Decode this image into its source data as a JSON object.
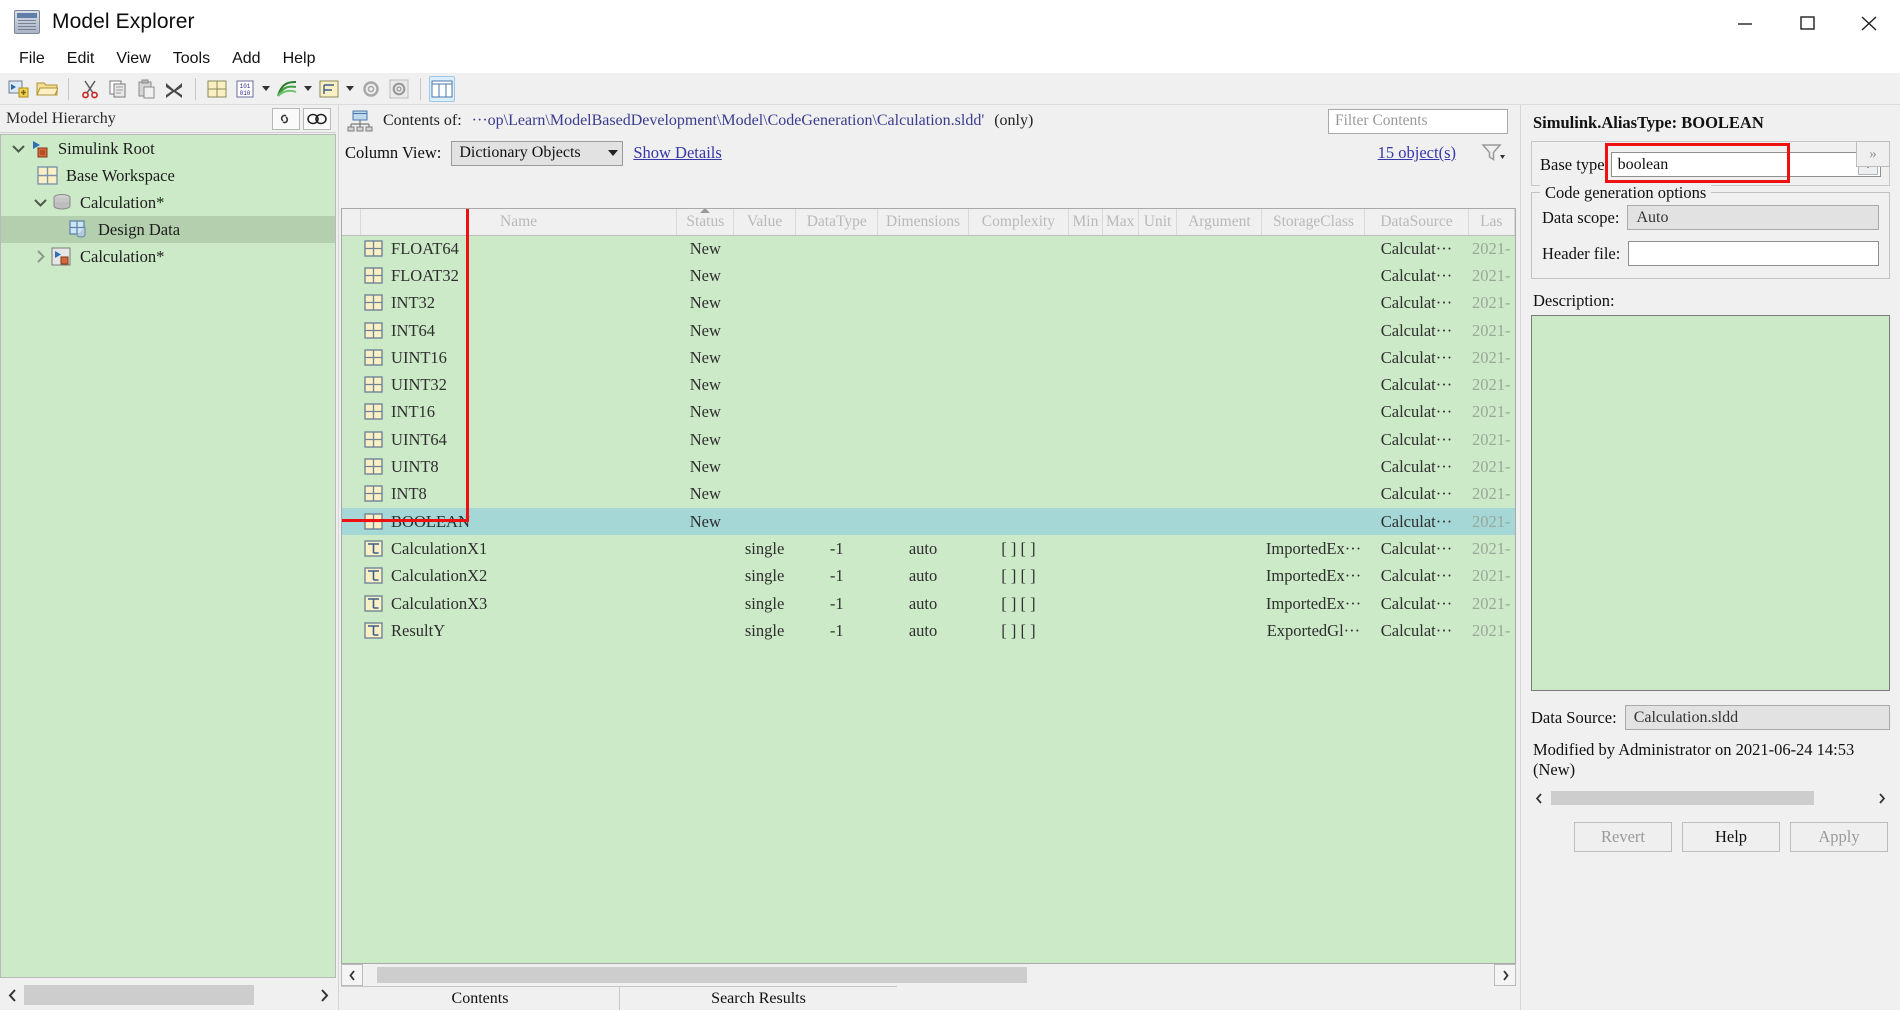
{
  "window": {
    "title": "Model Explorer",
    "app_icon": "grid-window-icon",
    "minimize": "minimize-icon",
    "maximize": "maximize-icon",
    "close": "close-icon"
  },
  "menubar": {
    "items": [
      "File",
      "Edit",
      "View",
      "Tools",
      "Add",
      "Help"
    ]
  },
  "toolbar": {
    "items": [
      "new-model-icon",
      "open-folder-icon",
      "cut-icon",
      "copy-icon",
      "paste-icon",
      "delete-x-icon",
      "base-workspace-icon",
      "code-bits-icon",
      "signal-icon",
      "hierarchy-icon",
      "config-gear-icon",
      "gear-icon",
      "columns-view-icon"
    ]
  },
  "left_panel": {
    "header": "Model Hierarchy",
    "header_buttons": [
      "link-icon",
      "mask-icon"
    ],
    "tree": [
      {
        "label": "Simulink Root",
        "icon": "simulink-root-icon",
        "twisty": "expanded",
        "indent": 0,
        "selected": false
      },
      {
        "label": "Base Workspace",
        "icon": "workspace-grid-icon",
        "twisty": "none",
        "indent": 1,
        "selected": false
      },
      {
        "label": "Calculation*",
        "icon": "dictionary-icon",
        "twisty": "expanded",
        "indent": 1,
        "selected": false
      },
      {
        "label": "Design Data",
        "icon": "design-data-icon",
        "twisty": "none",
        "indent": 2,
        "selected": true
      },
      {
        "label": "Calculation*",
        "icon": "model-icon",
        "twisty": "collapsed",
        "indent": 1,
        "selected": false
      }
    ]
  },
  "center_panel": {
    "contents_label": "Contents of:",
    "contents_path": "···op\\Learn\\ModelBasedDevelopment\\Model\\CodeGeneration\\Calculation.sldd'",
    "contents_only": "(only)",
    "filter_placeholder": "Filter Contents",
    "column_view_label": "Column View:",
    "column_view_value": "Dictionary Objects",
    "show_details": "Show Details",
    "object_count": "15 object(s)",
    "filter_icon": "funnel-icon",
    "columns": [
      "",
      "Name",
      "Status",
      "Value",
      "DataType",
      "Dimensions",
      "Complexity",
      "Min",
      "Max",
      "Unit",
      "Argument",
      "StorageClass",
      "DataSource",
      "Las"
    ],
    "sorted_column": "Status",
    "rows": [
      {
        "icon": "alias-type-icon",
        "name": "FLOAT64",
        "status": "New",
        "value": "",
        "datatype": "",
        "dimensions": "",
        "complexity": "",
        "min": "",
        "max": "",
        "unit": "",
        "argument": "",
        "storageclass": "",
        "datasource": "Calculat···",
        "last": "2021-",
        "selected": false
      },
      {
        "icon": "alias-type-icon",
        "name": "FLOAT32",
        "status": "New",
        "value": "",
        "datatype": "",
        "dimensions": "",
        "complexity": "",
        "min": "",
        "max": "",
        "unit": "",
        "argument": "",
        "storageclass": "",
        "datasource": "Calculat···",
        "last": "2021-",
        "selected": false
      },
      {
        "icon": "alias-type-icon",
        "name": "INT32",
        "status": "New",
        "value": "",
        "datatype": "",
        "dimensions": "",
        "complexity": "",
        "min": "",
        "max": "",
        "unit": "",
        "argument": "",
        "storageclass": "",
        "datasource": "Calculat···",
        "last": "2021-",
        "selected": false
      },
      {
        "icon": "alias-type-icon",
        "name": "INT64",
        "status": "New",
        "value": "",
        "datatype": "",
        "dimensions": "",
        "complexity": "",
        "min": "",
        "max": "",
        "unit": "",
        "argument": "",
        "storageclass": "",
        "datasource": "Calculat···",
        "last": "2021-",
        "selected": false
      },
      {
        "icon": "alias-type-icon",
        "name": "UINT16",
        "status": "New",
        "value": "",
        "datatype": "",
        "dimensions": "",
        "complexity": "",
        "min": "",
        "max": "",
        "unit": "",
        "argument": "",
        "storageclass": "",
        "datasource": "Calculat···",
        "last": "2021-",
        "selected": false
      },
      {
        "icon": "alias-type-icon",
        "name": "UINT32",
        "status": "New",
        "value": "",
        "datatype": "",
        "dimensions": "",
        "complexity": "",
        "min": "",
        "max": "",
        "unit": "",
        "argument": "",
        "storageclass": "",
        "datasource": "Calculat···",
        "last": "2021-",
        "selected": false
      },
      {
        "icon": "alias-type-icon",
        "name": "INT16",
        "status": "New",
        "value": "",
        "datatype": "",
        "dimensions": "",
        "complexity": "",
        "min": "",
        "max": "",
        "unit": "",
        "argument": "",
        "storageclass": "",
        "datasource": "Calculat···",
        "last": "2021-",
        "selected": false
      },
      {
        "icon": "alias-type-icon",
        "name": "UINT64",
        "status": "New",
        "value": "",
        "datatype": "",
        "dimensions": "",
        "complexity": "",
        "min": "",
        "max": "",
        "unit": "",
        "argument": "",
        "storageclass": "",
        "datasource": "Calculat···",
        "last": "2021-",
        "selected": false
      },
      {
        "icon": "alias-type-icon",
        "name": "UINT8",
        "status": "New",
        "value": "",
        "datatype": "",
        "dimensions": "",
        "complexity": "",
        "min": "",
        "max": "",
        "unit": "",
        "argument": "",
        "storageclass": "",
        "datasource": "Calculat···",
        "last": "2021-",
        "selected": false
      },
      {
        "icon": "alias-type-icon",
        "name": "INT8",
        "status": "New",
        "value": "",
        "datatype": "",
        "dimensions": "",
        "complexity": "",
        "min": "",
        "max": "",
        "unit": "",
        "argument": "",
        "storageclass": "",
        "datasource": "Calculat···",
        "last": "2021-",
        "selected": false
      },
      {
        "icon": "alias-type-icon",
        "name": "BOOLEAN",
        "status": "New",
        "value": "",
        "datatype": "",
        "dimensions": "",
        "complexity": "",
        "min": "",
        "max": "",
        "unit": "",
        "argument": "",
        "storageclass": "",
        "datasource": "Calculat···",
        "last": "2021-",
        "selected": true
      },
      {
        "icon": "parameter-icon",
        "name": "CalculationX1",
        "status": "",
        "value": "single",
        "datatype": "-1",
        "dimensions": "auto",
        "complexity": "[ ] [ ]",
        "min": "",
        "max": "",
        "unit": "",
        "argument": "",
        "storageclass": "ImportedEx···",
        "datasource": "Calculat···",
        "last": "2021-",
        "selected": false
      },
      {
        "icon": "parameter-icon",
        "name": "CalculationX2",
        "status": "",
        "value": "single",
        "datatype": "-1",
        "dimensions": "auto",
        "complexity": "[ ] [ ]",
        "min": "",
        "max": "",
        "unit": "",
        "argument": "",
        "storageclass": "ImportedEx···",
        "datasource": "Calculat···",
        "last": "2021-",
        "selected": false
      },
      {
        "icon": "parameter-icon",
        "name": "CalculationX3",
        "status": "",
        "value": "single",
        "datatype": "-1",
        "dimensions": "auto",
        "complexity": "[ ] [ ]",
        "min": "",
        "max": "",
        "unit": "",
        "argument": "",
        "storageclass": "ImportedEx···",
        "datasource": "Calculat···",
        "last": "2021-",
        "selected": false
      },
      {
        "icon": "parameter-icon",
        "name": "ResultY",
        "status": "",
        "value": "single",
        "datatype": "-1",
        "dimensions": "auto",
        "complexity": "[ ] [ ]",
        "min": "",
        "max": "",
        "unit": "",
        "argument": "",
        "storageclass": "ExportedGl···",
        "datasource": "Calculat···",
        "last": "2021-",
        "selected": false
      }
    ],
    "tabs": [
      {
        "label": "Contents",
        "active": true
      },
      {
        "label": "Search Results",
        "active": false
      }
    ]
  },
  "right_panel": {
    "title": "Simulink.AliasType: BOOLEAN",
    "base_type_label": "Base type",
    "base_type_value": "boolean",
    "codegen_group": "Code generation options",
    "data_scope_label": "Data scope:",
    "data_scope_value": "Auto",
    "header_file_label": "Header file:",
    "header_file_value": "",
    "description_label": "Description:",
    "description_value": "",
    "data_source_label": "Data Source:",
    "data_source_value": "Calculation.sldd",
    "modified_line": "Modified by Administrator on 2021-06-24 14:53 (New)",
    "buttons": [
      {
        "label": "Revert",
        "enabled": false
      },
      {
        "label": "Help",
        "enabled": true
      },
      {
        "label": "Apply",
        "enabled": false
      }
    ],
    "expand_button": "expand-chevrons-icon"
  },
  "annotations": {
    "highlight_color": "#ee1111",
    "name_column_box": "red-rect-name-column",
    "base_type_box": "red-rect-base-type"
  },
  "colors": {
    "row_background": "#cdeac8",
    "selected_row": "#a4d7d6",
    "tree_selected": "#b3cfae",
    "link": "#3636a8"
  }
}
